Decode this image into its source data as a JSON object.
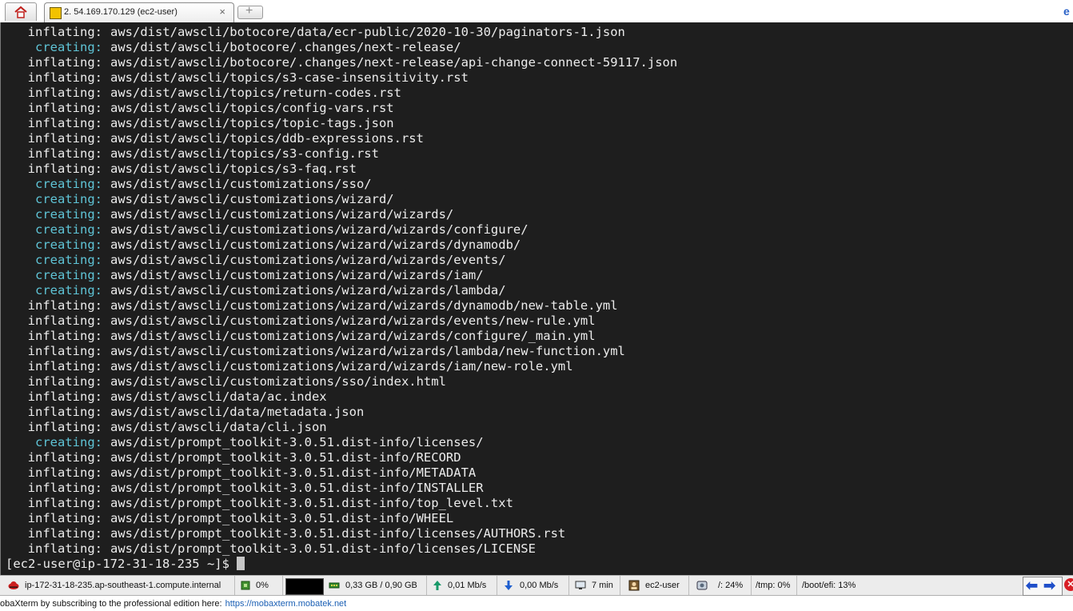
{
  "tabbar": {
    "tab_title": "2. 54.169.170.129 (ec2-user)",
    "close_glyph": "×",
    "new_tab_glyph": "+",
    "corner_glyph": "e"
  },
  "terminal": {
    "lines": [
      {
        "kw": "inflating:",
        "path": "aws/dist/awscli/botocore/data/ecr-public/2020-10-30/paginators-1.json"
      },
      {
        "kw": "creating:",
        "path": "aws/dist/awscli/botocore/.changes/next-release/"
      },
      {
        "kw": "inflating:",
        "path": "aws/dist/awscli/botocore/.changes/next-release/api-change-connect-59117.json"
      },
      {
        "kw": "inflating:",
        "path": "aws/dist/awscli/topics/s3-case-insensitivity.rst"
      },
      {
        "kw": "inflating:",
        "path": "aws/dist/awscli/topics/return-codes.rst"
      },
      {
        "kw": "inflating:",
        "path": "aws/dist/awscli/topics/config-vars.rst"
      },
      {
        "kw": "inflating:",
        "path": "aws/dist/awscli/topics/topic-tags.json"
      },
      {
        "kw": "inflating:",
        "path": "aws/dist/awscli/topics/ddb-expressions.rst"
      },
      {
        "kw": "inflating:",
        "path": "aws/dist/awscli/topics/s3-config.rst"
      },
      {
        "kw": "inflating:",
        "path": "aws/dist/awscli/topics/s3-faq.rst"
      },
      {
        "kw": "creating:",
        "path": "aws/dist/awscli/customizations/sso/"
      },
      {
        "kw": "creating:",
        "path": "aws/dist/awscli/customizations/wizard/"
      },
      {
        "kw": "creating:",
        "path": "aws/dist/awscli/customizations/wizard/wizards/"
      },
      {
        "kw": "creating:",
        "path": "aws/dist/awscli/customizations/wizard/wizards/configure/"
      },
      {
        "kw": "creating:",
        "path": "aws/dist/awscli/customizations/wizard/wizards/dynamodb/"
      },
      {
        "kw": "creating:",
        "path": "aws/dist/awscli/customizations/wizard/wizards/events/"
      },
      {
        "kw": "creating:",
        "path": "aws/dist/awscli/customizations/wizard/wizards/iam/"
      },
      {
        "kw": "creating:",
        "path": "aws/dist/awscli/customizations/wizard/wizards/lambda/"
      },
      {
        "kw": "inflating:",
        "path": "aws/dist/awscli/customizations/wizard/wizards/dynamodb/new-table.yml"
      },
      {
        "kw": "inflating:",
        "path": "aws/dist/awscli/customizations/wizard/wizards/events/new-rule.yml"
      },
      {
        "kw": "inflating:",
        "path": "aws/dist/awscli/customizations/wizard/wizards/configure/_main.yml"
      },
      {
        "kw": "inflating:",
        "path": "aws/dist/awscli/customizations/wizard/wizards/lambda/new-function.yml"
      },
      {
        "kw": "inflating:",
        "path": "aws/dist/awscli/customizations/wizard/wizards/iam/new-role.yml"
      },
      {
        "kw": "inflating:",
        "path": "aws/dist/awscli/customizations/sso/index.html"
      },
      {
        "kw": "inflating:",
        "path": "aws/dist/awscli/data/ac.index"
      },
      {
        "kw": "inflating:",
        "path": "aws/dist/awscli/data/metadata.json"
      },
      {
        "kw": "inflating:",
        "path": "aws/dist/awscli/data/cli.json"
      },
      {
        "kw": "creating:",
        "path": "aws/dist/prompt_toolkit-3.0.51.dist-info/licenses/"
      },
      {
        "kw": "inflating:",
        "path": "aws/dist/prompt_toolkit-3.0.51.dist-info/RECORD"
      },
      {
        "kw": "inflating:",
        "path": "aws/dist/prompt_toolkit-3.0.51.dist-info/METADATA"
      },
      {
        "kw": "inflating:",
        "path": "aws/dist/prompt_toolkit-3.0.51.dist-info/INSTALLER"
      },
      {
        "kw": "inflating:",
        "path": "aws/dist/prompt_toolkit-3.0.51.dist-info/top_level.txt"
      },
      {
        "kw": "inflating:",
        "path": "aws/dist/prompt_toolkit-3.0.51.dist-info/WHEEL"
      },
      {
        "kw": "inflating:",
        "path": "aws/dist/prompt_toolkit-3.0.51.dist-info/licenses/AUTHORS.rst"
      },
      {
        "kw": "inflating:",
        "path": "aws/dist/prompt_toolkit-3.0.51.dist-info/licenses/LICENSE"
      }
    ],
    "prompt": "[ec2-user@ip-172-31-18-235 ~]$",
    "colors": {
      "background": "#1e1e1e",
      "text": "#ececec",
      "creating": "#5fc4d6"
    }
  },
  "statusbar": {
    "hostname": "ip-172-31-18-235.ap-southeast-1.compute.internal",
    "cpu": "0%",
    "memory": "0,33 GB / 0,90 GB",
    "upload": "0,01 Mb/s",
    "download": "0,00 Mb/s",
    "uptime": "7 min",
    "user": "ec2-user",
    "disk_root": "/: 24%",
    "disk_tmp": "/tmp: 0%",
    "disk_boot": "/boot/efi: 13%",
    "icons": [
      "redhat-icon",
      "cpu-icon",
      "memory-icon",
      "upload-icon",
      "download-icon",
      "monitor-icon",
      "user-icon",
      "disk-icon",
      "back-arrow-icon",
      "forward-arrow-icon",
      "close-icon"
    ]
  },
  "footer": {
    "message": "obaXterm by subscribing to the professional edition here:",
    "link": "https://mobaxterm.mobatek.net"
  }
}
